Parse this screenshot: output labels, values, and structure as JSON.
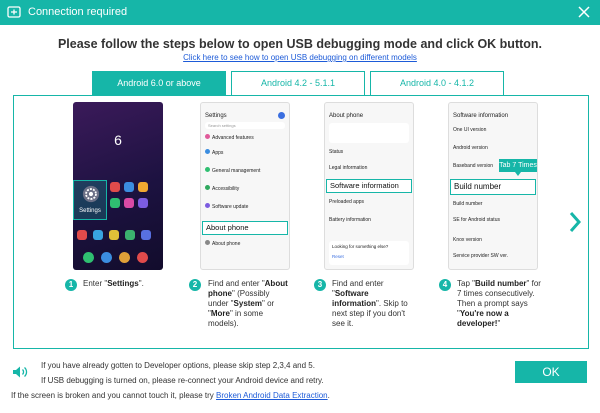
{
  "window": {
    "title": "Connection required",
    "accent_color": "#16b6a8",
    "link_color": "#1d5bd8"
  },
  "main": {
    "heading": "Please follow the steps below to open USB debugging mode and click OK button.",
    "help_link": "Click here to see how to open USB debugging on different models"
  },
  "tabs": [
    {
      "label": "Android 6.0 or above",
      "active": true
    },
    {
      "label": "Android 4.2 - 5.1.1",
      "active": false
    },
    {
      "label": "Android 4.0 - 4.1.2",
      "active": false
    }
  ],
  "phone1": {
    "clock": "6",
    "settings_label": "Settings"
  },
  "phone2": {
    "title": "Settings",
    "search": "Search settings",
    "items": [
      "Advanced features",
      "Apps",
      "General management",
      "Accessibility",
      "Software update"
    ],
    "highlight": "About phone",
    "bottom": "About phone"
  },
  "phone3": {
    "title": "About phone",
    "items": [
      "Status",
      "Legal information"
    ],
    "highlight": "Software information",
    "items_after": [
      "Preloaded apps",
      "Battery information"
    ],
    "footer": "Looking for something else?",
    "footer_link": "Reset"
  },
  "phone4": {
    "title": "Software information",
    "items": [
      "One UI version",
      "Android version",
      "Baseband version"
    ],
    "tap_hint": "Tab 7 Times",
    "highlight": "Build number",
    "items_after": [
      "Build number",
      "SE for Android status",
      "Knox version",
      "Service provider SW ver."
    ]
  },
  "steps": [
    {
      "num": "1",
      "pre": "Enter \"",
      "bold": "Settings",
      "post": "\"."
    },
    {
      "num": "2",
      "html_parts": [
        "Find and enter \"",
        "About phone",
        "\" (Possibly under \"",
        "System",
        "\" or \"",
        "More",
        "\" in some models)."
      ]
    },
    {
      "num": "3",
      "html_parts": [
        "Find and enter \"",
        "Software information",
        "\". Skip to next step if you don't see it."
      ]
    },
    {
      "num": "4",
      "html_parts": [
        "Tap \"",
        "Build number",
        "\" for 7 times consecutively. Then a prompt says \"",
        "You're now a developer!",
        "\""
      ]
    }
  ],
  "footer": {
    "note1": "If you have already gotten to Developer options, please skip step 2,3,4 and 5.",
    "note2": "If USB debugging is turned on, please re-connect your Android device and retry.",
    "note3_pre": "If the screen is broken and you cannot touch it, please try ",
    "note3_link": "Broken Android Data Extraction",
    "note3_post": ".",
    "ok": "OK"
  },
  "icons": [
    "usb-icon",
    "close-icon",
    "chevron-right-icon",
    "speaker-icon",
    "gear-icon"
  ]
}
